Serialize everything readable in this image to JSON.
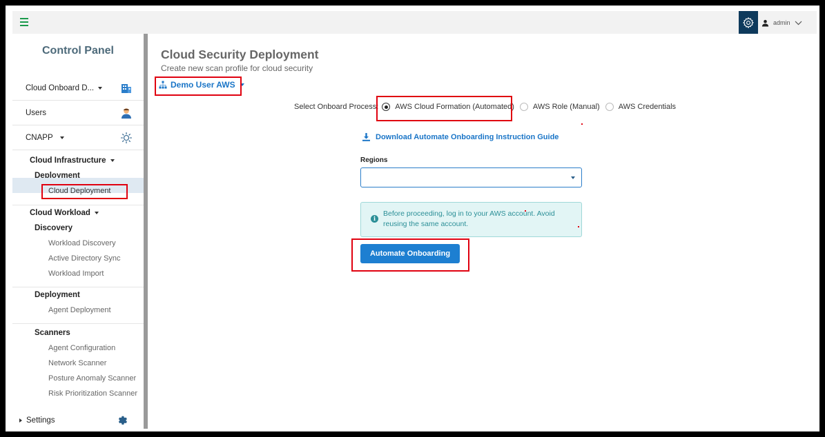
{
  "topbar": {
    "user_name": "admin"
  },
  "sidebar": {
    "title": "Control Panel",
    "top_items": [
      {
        "label": "Cloud Onboard D..."
      },
      {
        "label": "Users"
      },
      {
        "label": "CNAPP"
      }
    ],
    "cloud_infrastructure": "Cloud Infrastructure",
    "deployment": "Deployment",
    "cloud_deployment": "Cloud Deployment",
    "cloud_workload": "Cloud Workload",
    "discovery": "Discovery",
    "discovery_items": [
      "Workload Discovery",
      "Active Directory Sync",
      "Workload Import"
    ],
    "deployment2": "Deployment",
    "agent_deployment": "Agent Deployment",
    "scanners": "Scanners",
    "scanner_items": [
      "Agent Configuration",
      "Network Scanner",
      "Posture Anomaly Scanner",
      "Risk Prioritization Scanner"
    ],
    "settings": "Settings"
  },
  "main": {
    "title": "Cloud Security Deployment",
    "subtitle": "Create new scan profile for cloud security",
    "profile": "Demo User AWS",
    "onboard_label": "Select Onboard Process:",
    "options": [
      {
        "label": "AWS Cloud Formation (Automated)",
        "selected": true
      },
      {
        "label": "AWS Role (Manual)",
        "selected": false
      },
      {
        "label": "AWS Credentials",
        "selected": false
      }
    ],
    "download_link": "Download Automate Onboarding Instruction Guide",
    "regions_label": "Regions",
    "regions_value": "",
    "alert_text": "Before proceeding, log in to your AWS account. Avoid reusing the same account.",
    "button_label": "Automate Onboarding"
  },
  "colors": {
    "accent": "#1d7fd1",
    "highlight_box": "#e0000f",
    "topbar_gear_bg": "#0e3a5c"
  }
}
